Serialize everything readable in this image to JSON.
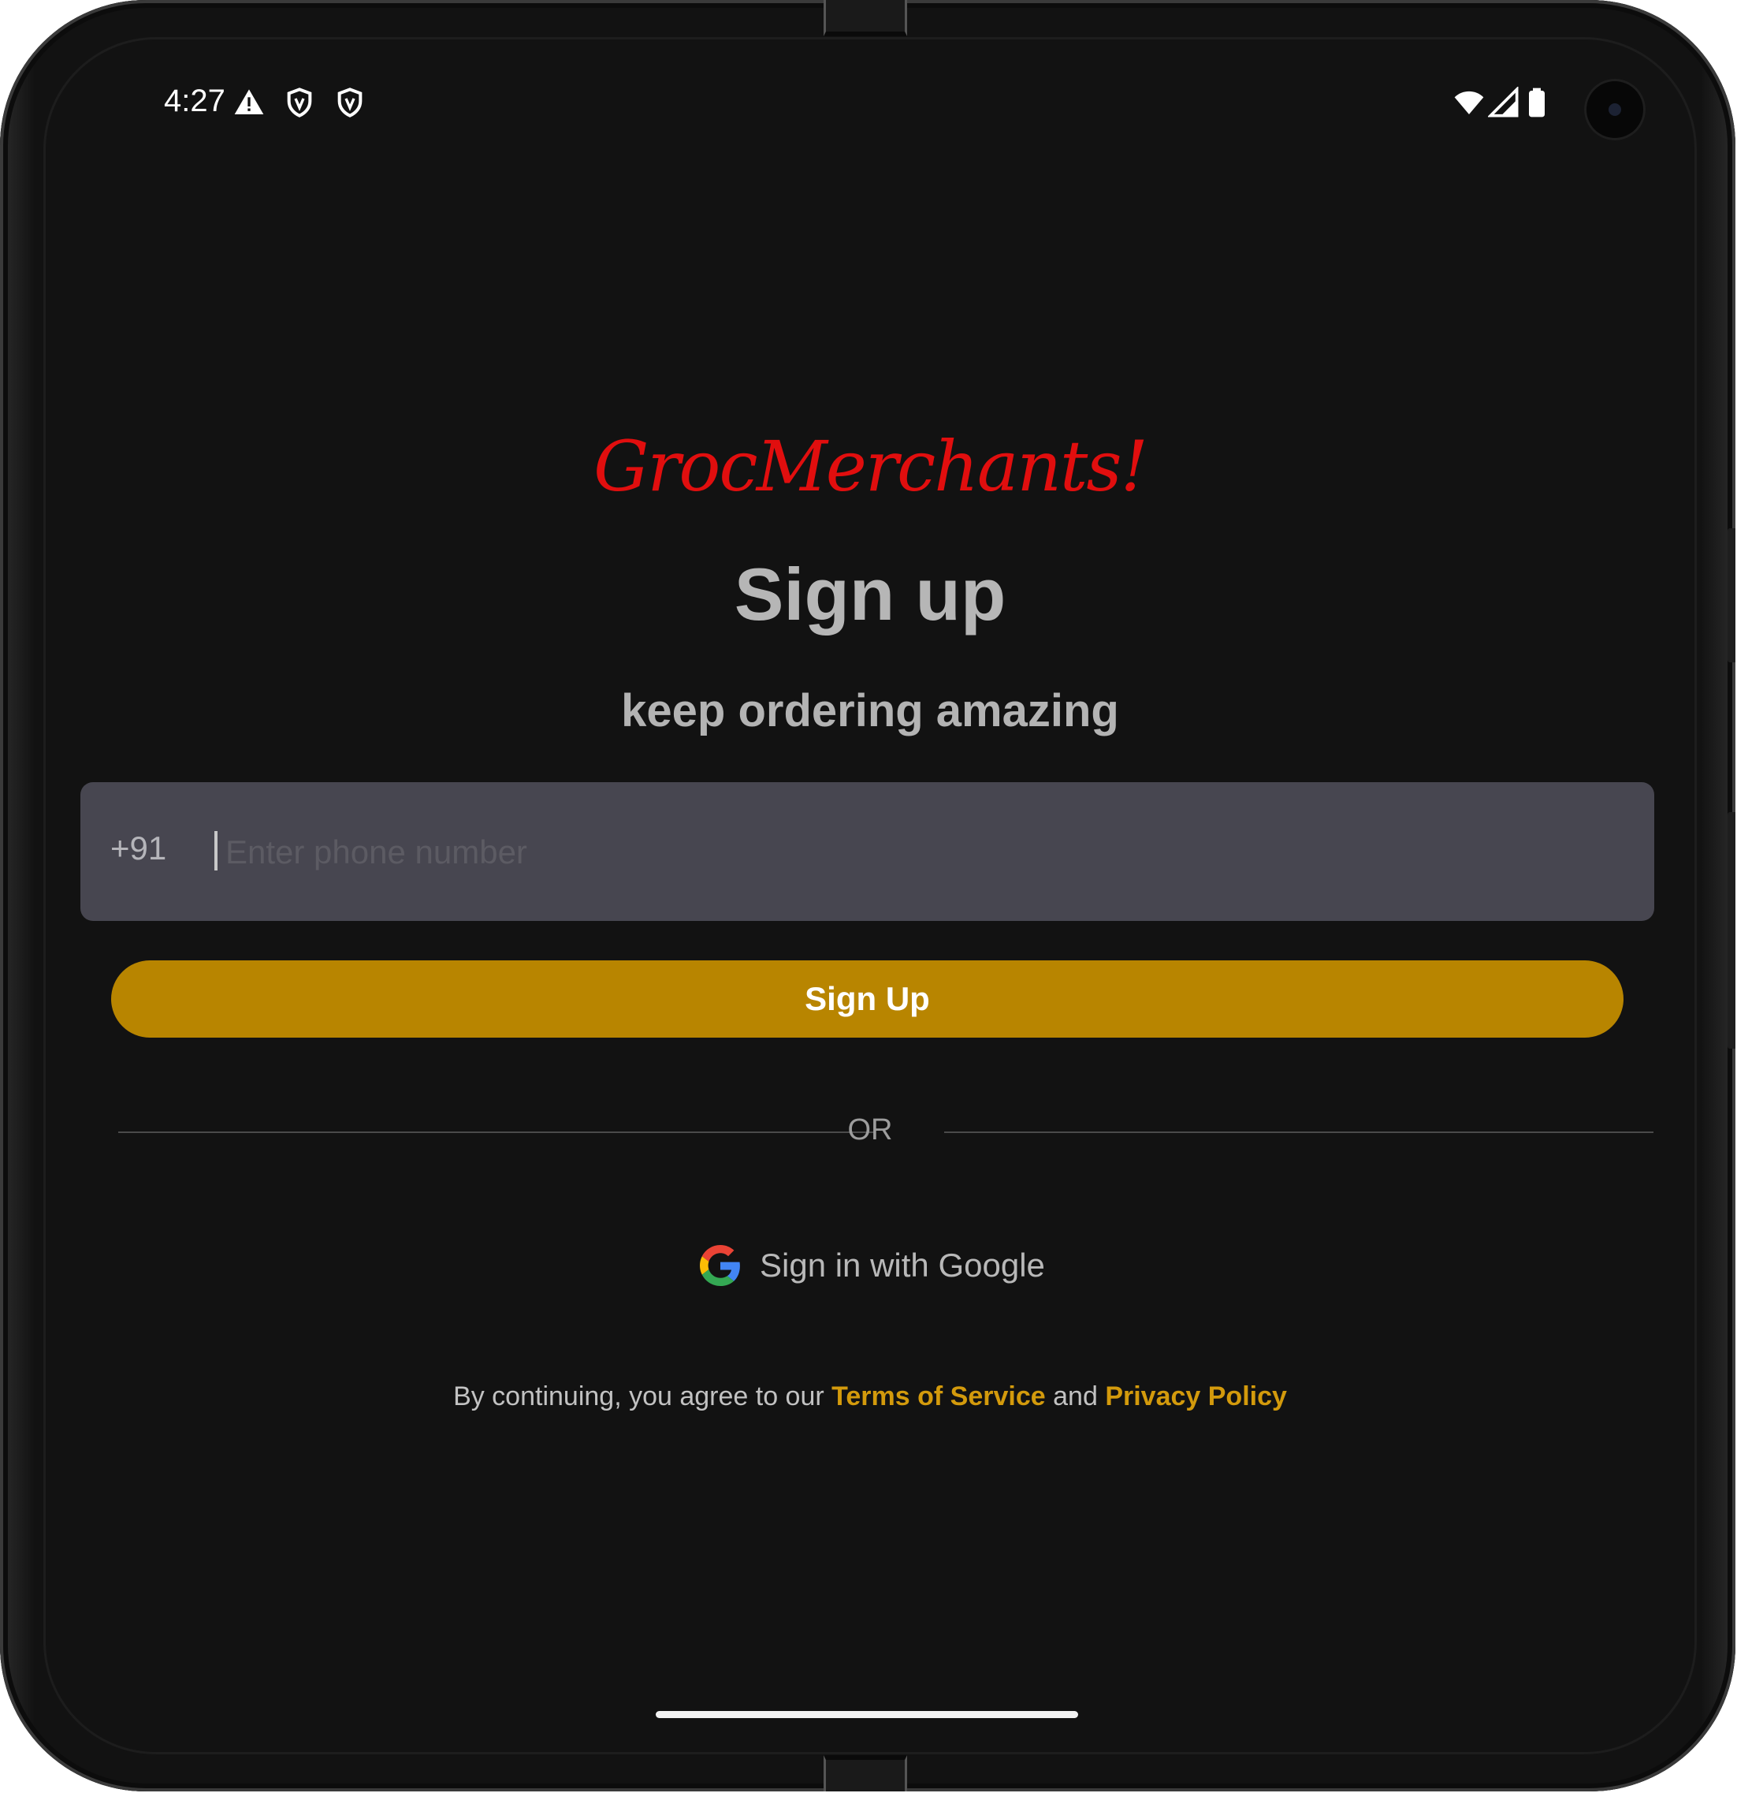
{
  "status_bar": {
    "time": "4:27",
    "left_icons": [
      "warning-icon",
      "shield-icon",
      "shield-icon"
    ],
    "right_icons": [
      "wifi-icon",
      "signal-icon",
      "battery-icon"
    ]
  },
  "brand": {
    "name": "GrocMerchants!",
    "color": "#e10e0e"
  },
  "header": {
    "title": "Sign up",
    "subtitle": "keep ordering amazing"
  },
  "phone_field": {
    "country_code": "+91",
    "placeholder": "Enter phone number",
    "value": ""
  },
  "actions": {
    "signup_label": "Sign Up",
    "divider_label": "OR",
    "google_label": "Sign in with Google"
  },
  "legal": {
    "prefix": "By continuing, you agree to our",
    "terms": "Terms of Service",
    "connector": "and",
    "privacy": "Privacy Policy"
  },
  "colors": {
    "accent": "#b88500",
    "link": "#d39a0c",
    "background": "#121212",
    "input_background": "#474650"
  }
}
